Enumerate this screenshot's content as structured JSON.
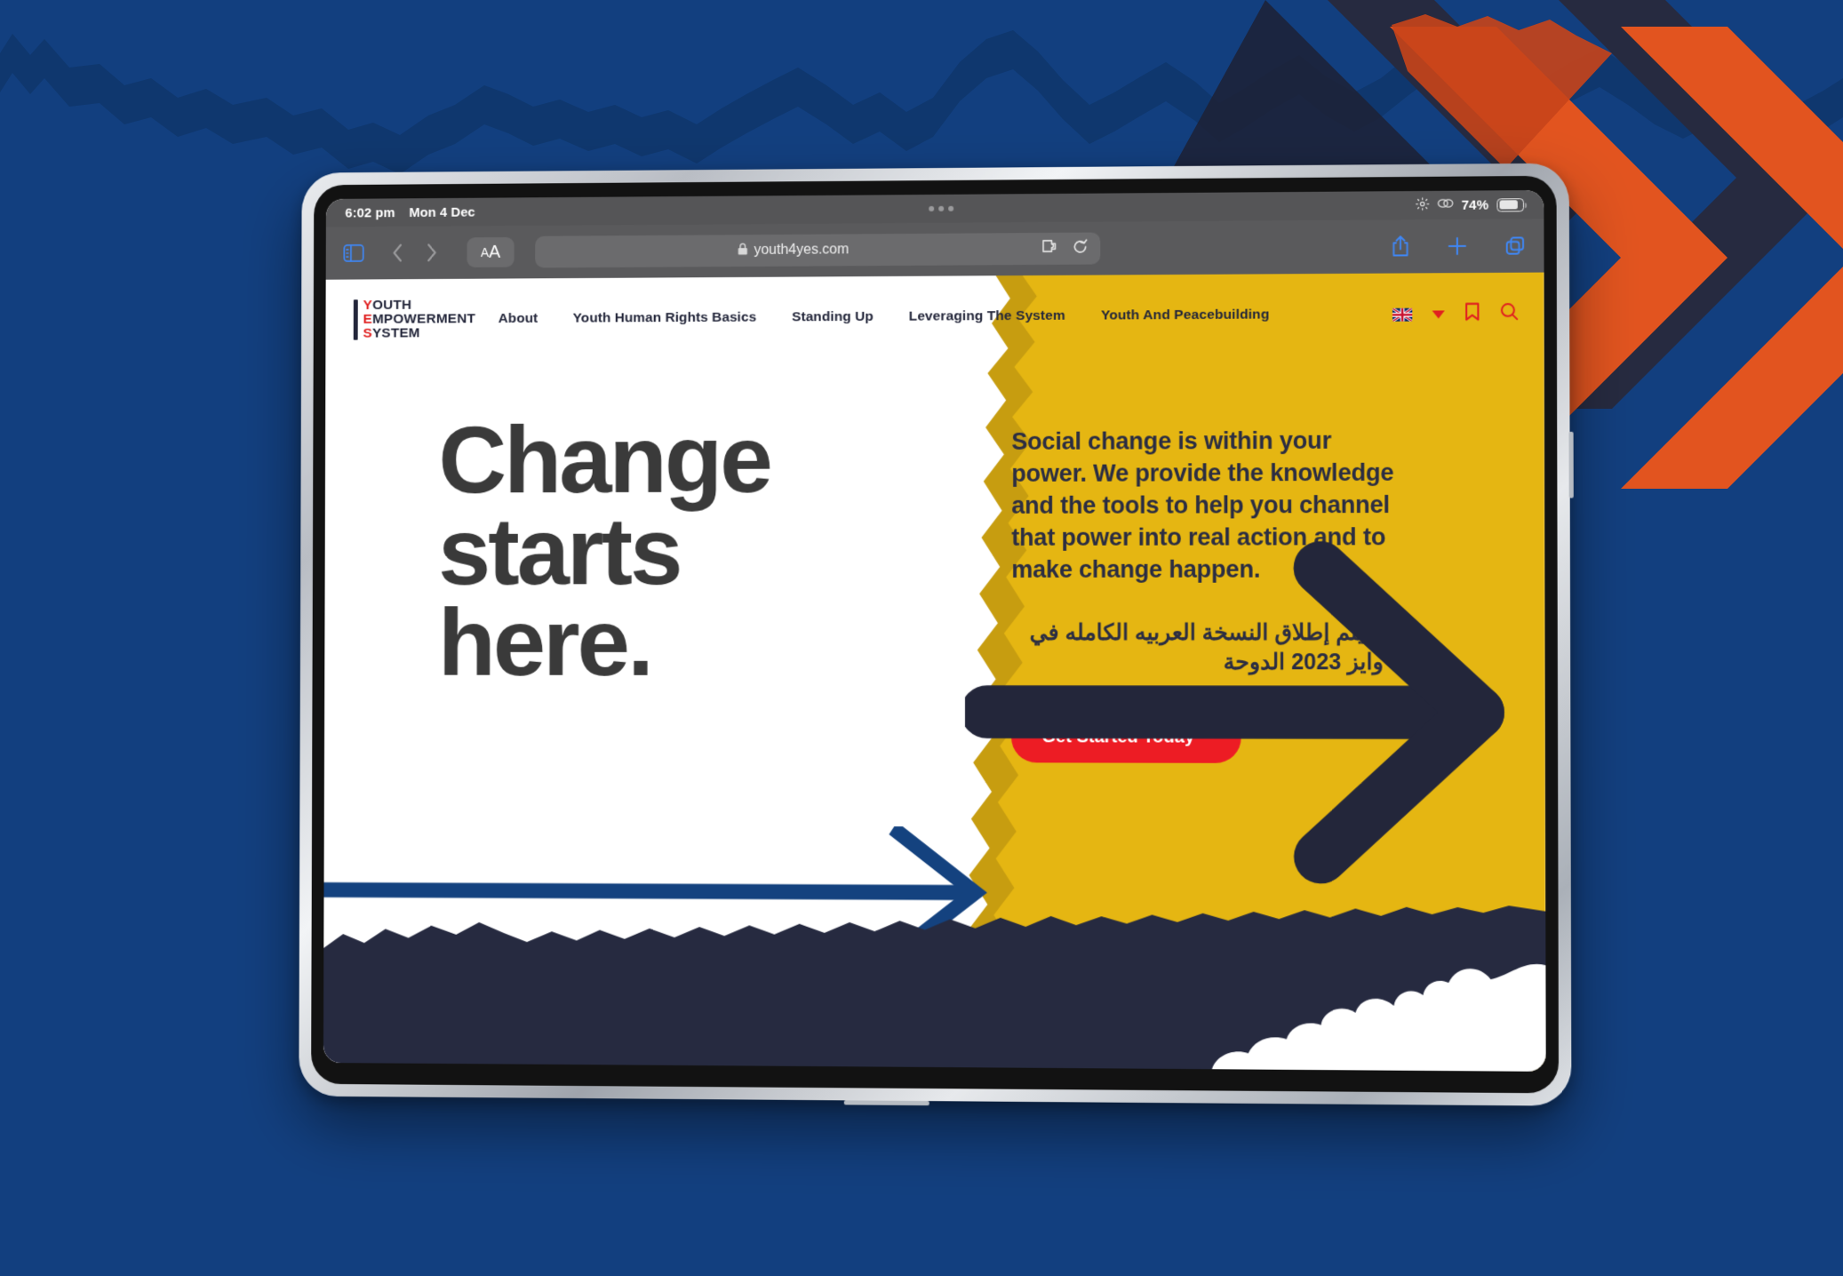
{
  "colors": {
    "poster_blue": "#123f7f",
    "navy": "#262a40",
    "brand_yellow": "#e5b612",
    "brand_yellow_shadow": "#c79d10",
    "brand_red": "#ed1c24",
    "logo_red": "#e02020",
    "heading_grey": "#3a3a3a",
    "arrow_blue": "#14427f",
    "accent_orange": "#e2541f",
    "accent_green": "#8cc63e",
    "safari_chrome": "#5a5a5c",
    "safari_blue": "#3f87f5"
  },
  "device": {
    "statusbar": {
      "time": "6:02 pm",
      "date": "Mon 4 Dec",
      "battery_percent": "74%",
      "battery_level": 74,
      "icons": [
        "brightness-icon",
        "screen-mirroring-icon",
        "battery-icon"
      ]
    },
    "toolbar": {
      "sidebar_icon": "sidebar-icon",
      "back_icon": "chevron-left-icon",
      "forward_icon": "chevron-right-icon",
      "text_size_small": "A",
      "text_size_large": "A",
      "lock_icon": "lock-icon",
      "url": "youth4yes.com",
      "extensions_icon": "puzzle-extension-icon",
      "reload_icon": "reload-icon",
      "share_icon": "share-icon",
      "new_tab_label": "+",
      "tabs_icon": "tabs-icon"
    }
  },
  "site": {
    "logo": {
      "line1_initial": "Y",
      "line1_rest": "OUTH",
      "line2_initial": "E",
      "line2_rest": "MPOWERMENT",
      "line3_initial": "S",
      "line3_rest": "YSTEM"
    },
    "nav": [
      {
        "label": "About"
      },
      {
        "label": "Youth Human Rights Basics"
      },
      {
        "label": "Standing Up"
      },
      {
        "label": "Leveraging The System"
      },
      {
        "label": "Youth And Peacebuilding"
      }
    ],
    "nav_right": {
      "language_flag": "uk-flag-icon",
      "language_caret": "chevron-down-icon",
      "bookmark_icon": "bookmark-icon",
      "search_icon": "search-icon"
    },
    "hero": {
      "line1": "Change",
      "line2": "starts",
      "line3": "here.",
      "arrow_icon": "long-right-arrow-icon"
    },
    "panel": {
      "lead": "Social change is within your power. We provide the knowledge and the tools to help you channel that power into real action and to make change happen.",
      "arabic": "سيتم إطلاق النسخة العربيه الكامله في وايز 2023 الدوحة",
      "cta_label": "Get Started Today",
      "cta_arrow_icon": "arrow-right-icon"
    }
  }
}
